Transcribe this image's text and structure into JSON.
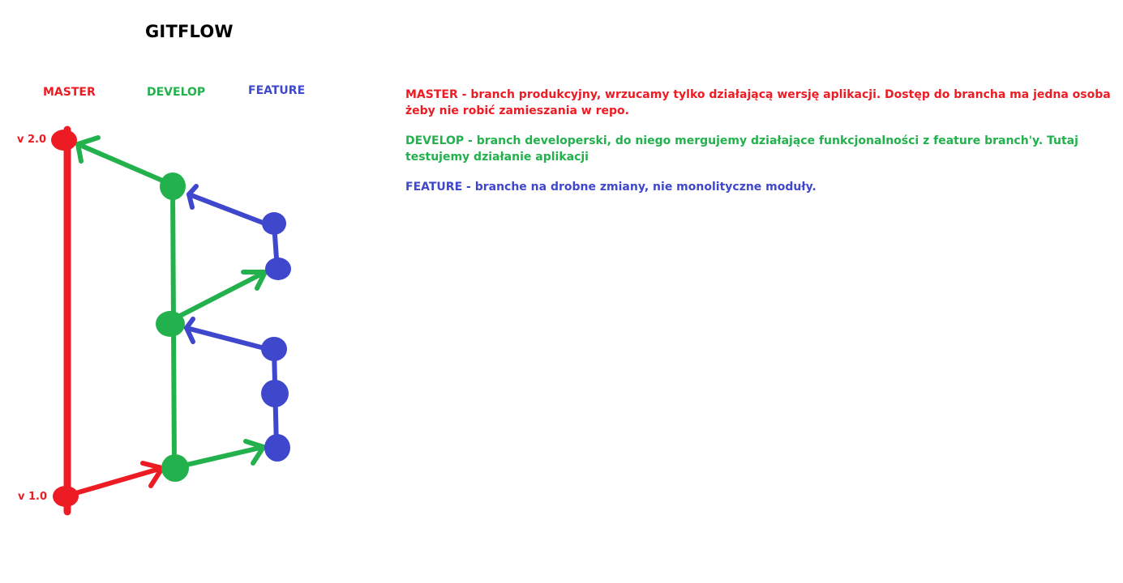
{
  "title": "GITFLOW",
  "colors": {
    "master": "#ed1c24",
    "develop": "#22b14c",
    "feature": "#3f48cc"
  },
  "branches": {
    "master": "MASTER",
    "develop": "DEVELOP",
    "feature": "FEATURE"
  },
  "versions": {
    "v2": "v 2.0",
    "v1": "v 1.0"
  },
  "legend": [
    {
      "term": "MASTER",
      "separator": " - ",
      "text": "branch produkcyjny, wrzucamy tylko działającą wersję aplikacji. Dostęp do brancha ma jedna osoba żeby nie robić zamieszania w repo."
    },
    {
      "term": "DEVELOP",
      "separator": " - ",
      "text": "branch developerski, do niego mergujemy działające funkcjonalności z feature branch'y. Tutaj testujemy działanie aplikacji"
    },
    {
      "term": "FEATURE",
      "separator": " - ",
      "text": "branche na drobne zmiany, nie monolityczne moduły."
    }
  ]
}
